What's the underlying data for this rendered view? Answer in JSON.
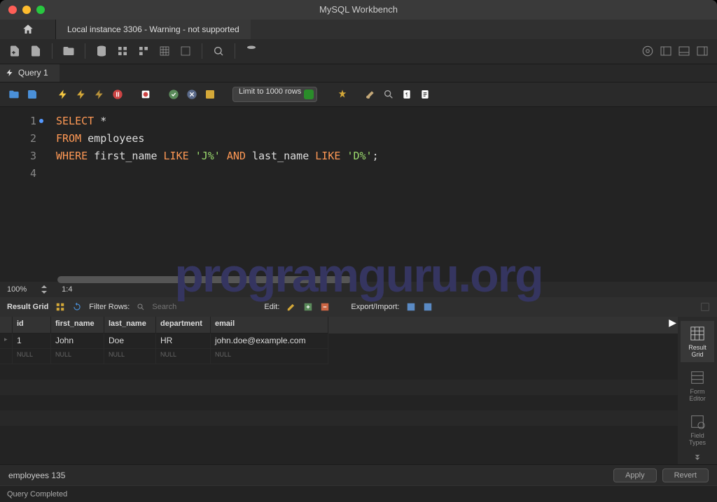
{
  "app_title": "MySQL Workbench",
  "connection_tab": "Local instance 3306 - Warning - not supported",
  "query_tab": "Query 1",
  "limit_select": "Limit to 1000 rows",
  "zoom": "100%",
  "cursor_pos": "1:4",
  "result_grid_label": "Result Grid",
  "filter_label": "Filter Rows:",
  "filter_placeholder": "Search",
  "edit_label": "Edit:",
  "export_label": "Export/Import:",
  "code_lines": [
    [
      {
        "t": "SELECT",
        "c": "kw"
      },
      {
        "t": " *",
        "c": ""
      }
    ],
    [
      {
        "t": "FROM",
        "c": "kw"
      },
      {
        "t": " employees",
        "c": ""
      }
    ],
    [
      {
        "t": "WHERE",
        "c": "kw"
      },
      {
        "t": " first_name ",
        "c": ""
      },
      {
        "t": "LIKE",
        "c": "kw"
      },
      {
        "t": " ",
        "c": ""
      },
      {
        "t": "'J%'",
        "c": "str"
      },
      {
        "t": " ",
        "c": ""
      },
      {
        "t": "AND",
        "c": "kw"
      },
      {
        "t": " last_name ",
        "c": ""
      },
      {
        "t": "LIKE",
        "c": "kw"
      },
      {
        "t": " ",
        "c": ""
      },
      {
        "t": "'D%'",
        "c": "str"
      },
      {
        "t": ";",
        "c": ""
      }
    ],
    [
      {
        "t": "",
        "c": ""
      }
    ]
  ],
  "columns": [
    "id",
    "first_name",
    "last_name",
    "department",
    "email"
  ],
  "rows": [
    [
      "1",
      "John",
      "Doe",
      "HR",
      "john.doe@example.com"
    ]
  ],
  "null_label": "NULL",
  "side_items": [
    {
      "label": "Result\nGrid",
      "active": true
    },
    {
      "label": "Form\nEditor",
      "active": false
    },
    {
      "label": "Field\nTypes",
      "active": false
    }
  ],
  "bottom_tab": "employees 135",
  "apply_btn": "Apply",
  "revert_btn": "Revert",
  "status": "Query Completed",
  "watermark": "programguru.org"
}
